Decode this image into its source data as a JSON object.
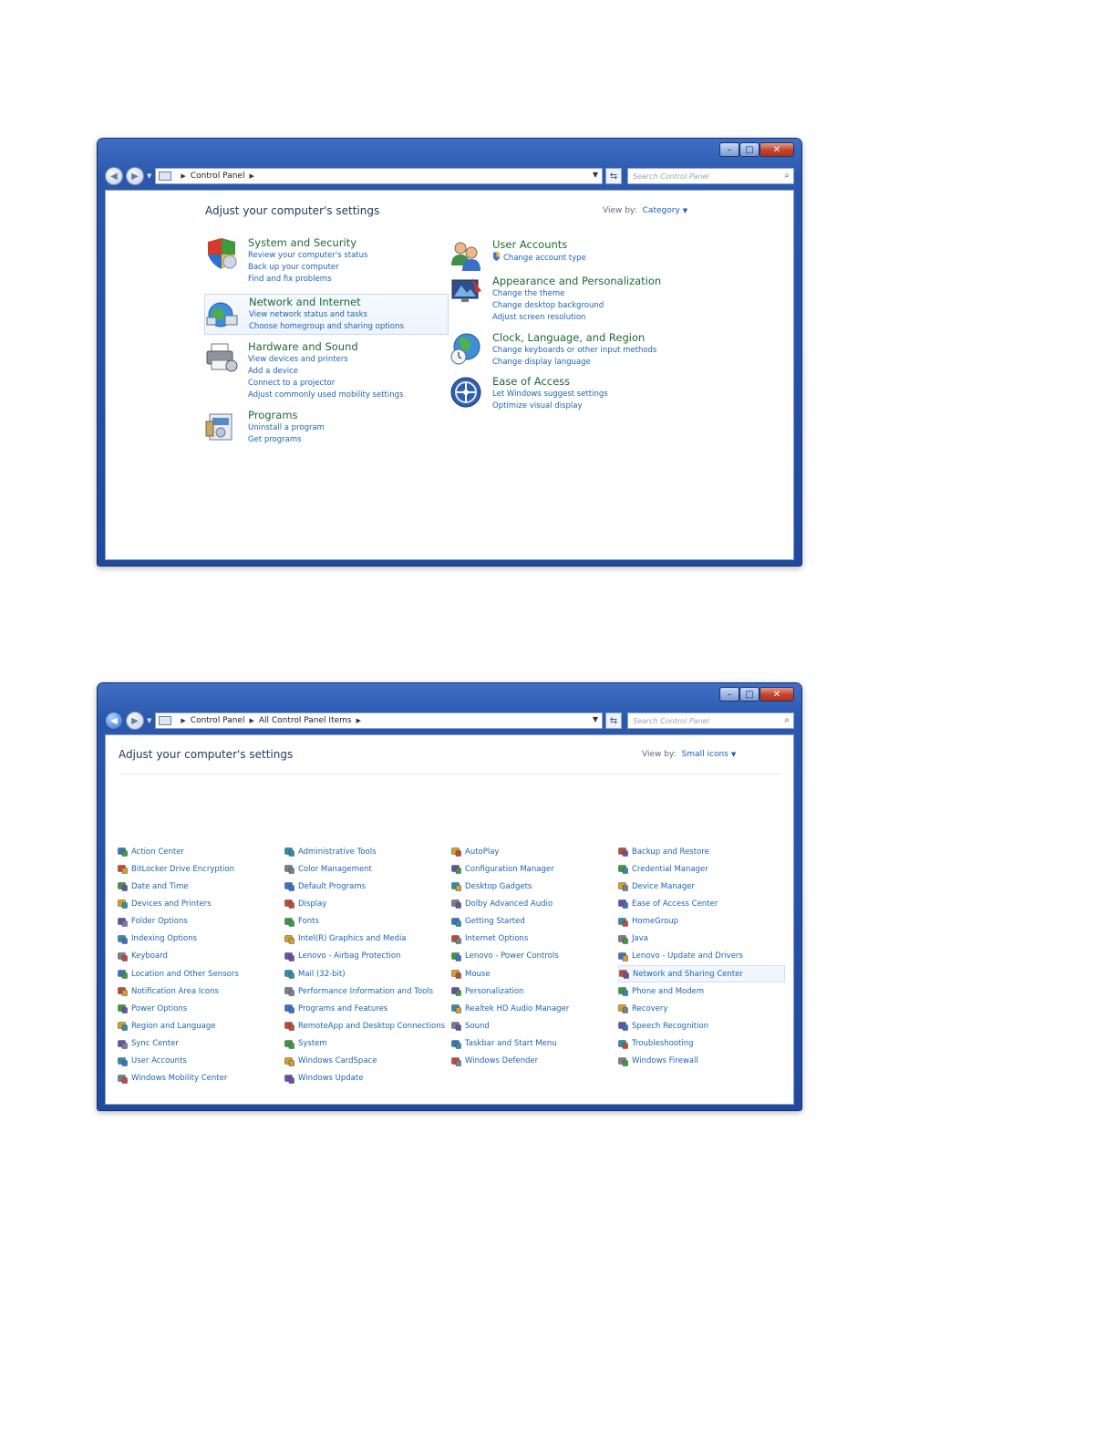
{
  "window1": {
    "breadcrumb": [
      "Control Panel"
    ],
    "search_placeholder": "Search Control Panel",
    "title": "Adjust your computer's settings",
    "view_by_label": "View by:",
    "view_by_value": "Category",
    "categories_left": [
      {
        "title": "System and Security",
        "icon": "shield-icon",
        "links": [
          "Review your computer's status",
          "Back up your computer",
          "Find and fix problems"
        ]
      },
      {
        "title": "Network and Internet",
        "icon": "network-icon",
        "links": [
          "View network status and tasks",
          "Choose homegroup and sharing options"
        ]
      },
      {
        "title": "Hardware and Sound",
        "icon": "printer-icon",
        "links": [
          "View devices and printers",
          "Add a device",
          "Connect to a projector",
          "Adjust commonly used mobility settings"
        ]
      },
      {
        "title": "Programs",
        "icon": "programs-icon",
        "links": [
          "Uninstall a program",
          "Get programs"
        ]
      }
    ],
    "categories_right": [
      {
        "title": "User Accounts",
        "icon": "users-icon",
        "links": [
          "Change account type"
        ]
      },
      {
        "title": "Appearance and Personalization",
        "icon": "monitor-icon",
        "links": [
          "Change the theme",
          "Change desktop background",
          "Adjust screen resolution"
        ]
      },
      {
        "title": "Clock, Language, and Region",
        "icon": "globe-clock-icon",
        "links": [
          "Change keyboards or other input methods",
          "Change display language"
        ]
      },
      {
        "title": "Ease of Access",
        "icon": "ease-of-access-icon",
        "links": [
          "Let Windows suggest settings",
          "Optimize visual display"
        ]
      }
    ]
  },
  "window2": {
    "breadcrumb": [
      "Control Panel",
      "All Control Panel Items"
    ],
    "search_placeholder": "Search Control Panel",
    "title": "Adjust your computer's settings",
    "view_by_label": "View by:",
    "view_by_value": "Small icons",
    "columns": [
      [
        "Action Center",
        "BitLocker Drive Encryption",
        "Date and Time",
        "Devices and Printers",
        "Folder Options",
        "Indexing Options",
        "Keyboard",
        "Location and Other Sensors",
        "Notification Area Icons",
        "Power Options",
        "Region and Language",
        "Sync Center",
        "User Accounts",
        "Windows Mobility Center"
      ],
      [
        "Administrative Tools",
        "Color Management",
        "Default Programs",
        "Display",
        "Fonts",
        "Intel(R) Graphics and Media",
        "Lenovo - Airbag Protection",
        "Mail (32-bit)",
        "Performance Information and Tools",
        "Programs and Features",
        "RemoteApp and Desktop Connections",
        "System",
        "Windows CardSpace",
        "Windows Update"
      ],
      [
        "AutoPlay",
        "Configuration Manager",
        "Desktop Gadgets",
        "Dolby Advanced Audio",
        "Getting Started",
        "Internet Options",
        "Lenovo - Power Controls",
        "Mouse",
        "Personalization",
        "Realtek HD Audio Manager",
        "Sound",
        "Taskbar and Start Menu",
        "Windows Defender"
      ],
      [
        "Backup and Restore",
        "Credential Manager",
        "Device Manager",
        "Ease of Access Center",
        "HomeGroup",
        "Java",
        "Lenovo - Update and Drivers",
        "Network and Sharing Center",
        "Phone and Modem",
        "Recovery",
        "Speech Recognition",
        "Troubleshooting",
        "Windows Firewall"
      ]
    ]
  },
  "colors": {
    "category_title": "#1d6a3a",
    "link": "#1a64b4",
    "window_frame": "#2b58ad"
  }
}
